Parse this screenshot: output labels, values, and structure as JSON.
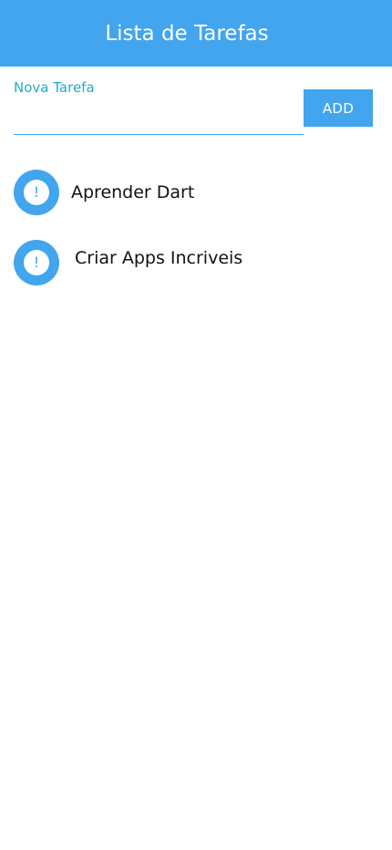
{
  "app_bar": {
    "title": "Lista de Tarefas"
  },
  "new_task": {
    "label": "Nova Tarefa",
    "value": "",
    "add_label": "ADD"
  },
  "tasks": [
    {
      "label": "Aprender Dart",
      "icon": "!"
    },
    {
      "label": "Criar Apps Incriveis",
      "icon": "!"
    }
  ],
  "colors": {
    "primary": "#42a5ee",
    "label": "#1eaecb",
    "text": "#111111",
    "background": "#ffffff"
  }
}
